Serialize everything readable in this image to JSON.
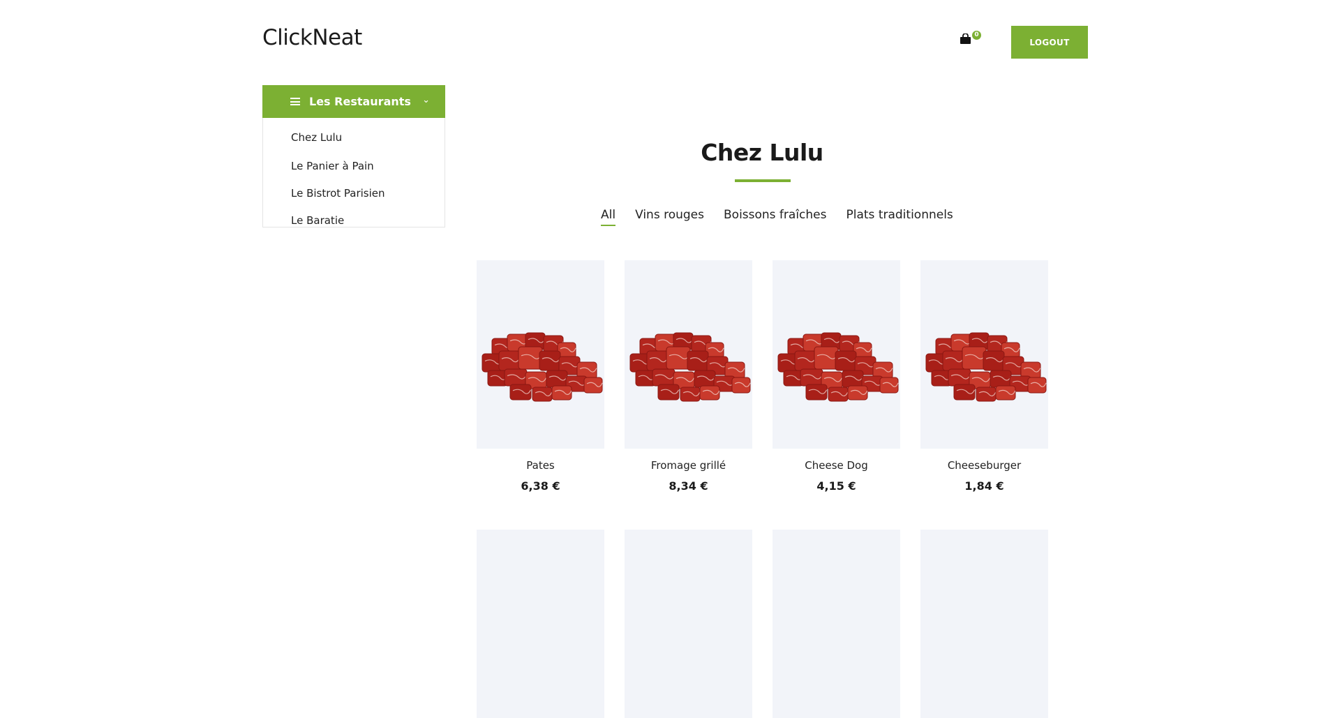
{
  "header": {
    "logo": "ClickNeat",
    "cart_count": "0",
    "logout_label": "LOGOUT"
  },
  "sidebar": {
    "title": "Les Restaurants",
    "items": [
      {
        "label": "Chez Lulu"
      },
      {
        "label": "Le Panier à Pain"
      },
      {
        "label": "Le Bistrot Parisien"
      },
      {
        "label": "Le Baratie"
      }
    ]
  },
  "main": {
    "title": "Chez Lulu",
    "filters": [
      {
        "label": "All",
        "active": true
      },
      {
        "label": "Vins rouges",
        "active": false
      },
      {
        "label": "Boissons fraîches",
        "active": false
      },
      {
        "label": "Plats traditionnels",
        "active": false
      }
    ],
    "products": [
      {
        "name": "Pates",
        "price": "6,38 €"
      },
      {
        "name": "Fromage grillé",
        "price": "8,34 €"
      },
      {
        "name": "Cheese Dog",
        "price": "4,15 €"
      },
      {
        "name": "Cheeseburger",
        "price": "1,84 €"
      }
    ]
  },
  "colors": {
    "accent": "#7cb033",
    "card_bg": "#f2f4f9"
  },
  "icons": {
    "cart": "shopping-bag-icon",
    "menu": "hamburger-icon",
    "chevron": "chevron-down-icon",
    "product_image": "raw-meat-cubes"
  }
}
